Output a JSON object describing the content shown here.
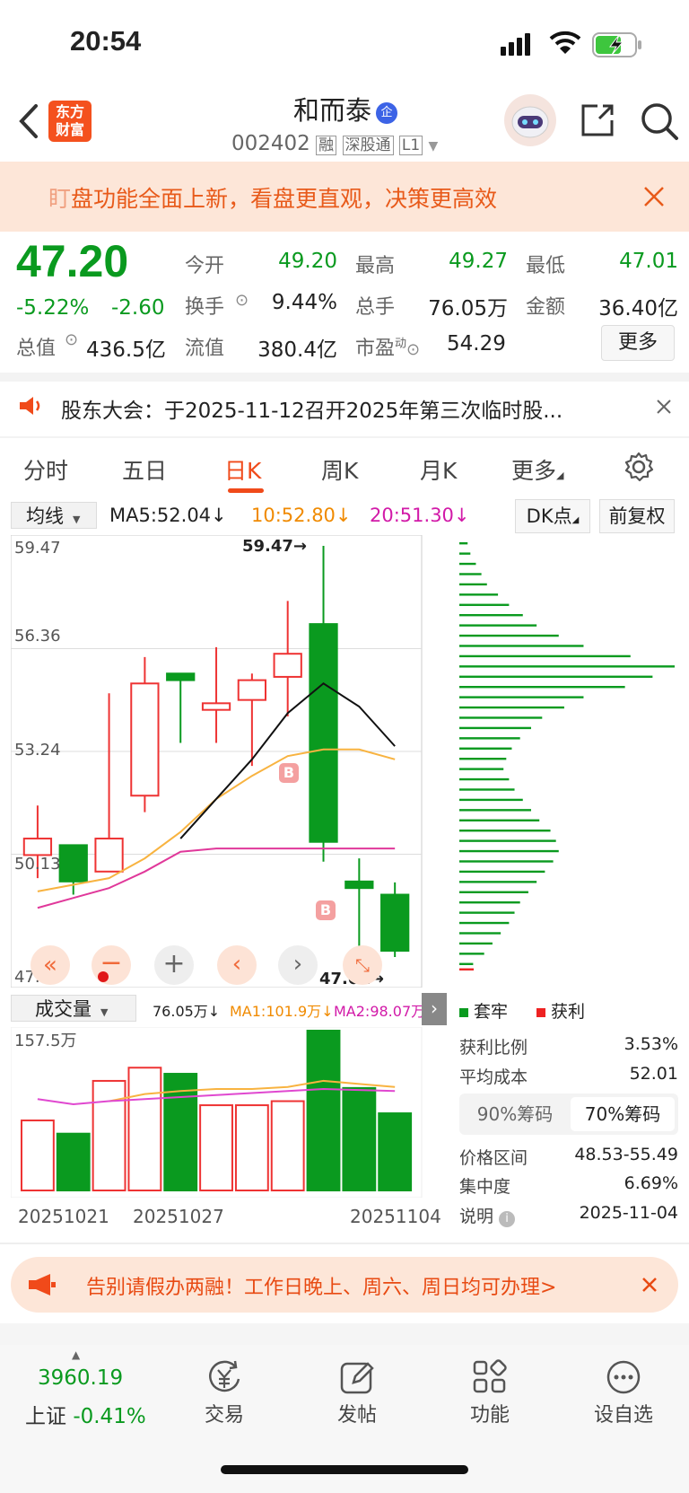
{
  "status": {
    "time": "20:54"
  },
  "header": {
    "logo_line1": "东方",
    "logo_line2": "财富",
    "stock_name": "和而泰",
    "badge": "企",
    "code": "002402",
    "tags": [
      "融",
      "深股通",
      "L1"
    ]
  },
  "banner1": {
    "prefix": "盯",
    "text": "盘功能全面上新，看盘更直观，决策更高效"
  },
  "quote": {
    "price": "47.20",
    "change_pct": "-5.22%",
    "change": "-2.60",
    "open_label": "今开",
    "open": "49.20",
    "high_label": "最高",
    "high": "49.27",
    "low_label": "最低",
    "low": "47.01",
    "turnover_label": "换手",
    "turnover": "9.44%",
    "volume_label": "总手",
    "volume": "76.05万",
    "amount_label": "金额",
    "amount": "36.40亿",
    "mktcap_label": "总值",
    "mktcap": "436.5亿",
    "float_label": "流值",
    "float": "380.4亿",
    "pe_label": "市盈",
    "pe_sup": "动",
    "pe": "54.29",
    "more_label": "更多"
  },
  "notice": {
    "text": "股东大会：于2025-11-12召开2025年第三次临时股..."
  },
  "tabs": [
    {
      "label": "分时"
    },
    {
      "label": "五日"
    },
    {
      "label": "日K",
      "active": true
    },
    {
      "label": "周K"
    },
    {
      "label": "月K"
    },
    {
      "label": "更多"
    }
  ],
  "ma_bar": {
    "selector": "均线",
    "ma5": "MA5:52.04↓",
    "ma10": "10:52.80↓",
    "ma20": "20:51.30↓",
    "dk": "DK点",
    "fq": "前复权"
  },
  "kchart": {
    "y_labels": [
      "59.47",
      "56.36",
      "53.24",
      "50.13",
      "47.01"
    ],
    "max_label": "59.47→",
    "min_label": "47.01→",
    "signal_b": "B"
  },
  "chart_data": {
    "type": "candlestick",
    "ylim": [
      47.01,
      59.47
    ],
    "candles": [
      {
        "open": 50.1,
        "close": 50.6,
        "high": 51.6,
        "low": 49.4
      },
      {
        "open": 50.4,
        "close": 49.3,
        "high": 50.4,
        "low": 48.9
      },
      {
        "open": 49.6,
        "close": 50.6,
        "high": 55.0,
        "low": 49.6
      },
      {
        "open": 51.9,
        "close": 55.3,
        "high": 56.1,
        "low": 51.4
      },
      {
        "open": 55.6,
        "close": 55.4,
        "high": 55.6,
        "low": 53.5
      },
      {
        "open": 54.5,
        "close": 54.7,
        "high": 56.4,
        "low": 53.5
      },
      {
        "open": 54.8,
        "close": 55.4,
        "high": 55.6,
        "low": 52.8
      },
      {
        "open": 55.5,
        "close": 56.2,
        "high": 57.8,
        "low": 54.3
      },
      {
        "open": 57.1,
        "close": 50.5,
        "high": 59.47,
        "low": 49.9
      },
      {
        "open": 49.3,
        "close": 49.1,
        "high": 50.0,
        "low": 47.3
      },
      {
        "open": 48.9,
        "close": 47.2,
        "high": 49.27,
        "low": 47.01
      }
    ],
    "ma5": [
      null,
      null,
      null,
      null,
      50.6,
      51.8,
      53.0,
      54.4,
      55.3,
      54.6,
      53.4
    ],
    "ma10": [
      49.0,
      49.2,
      49.4,
      50.0,
      50.8,
      51.8,
      52.5,
      53.1,
      53.3,
      53.3,
      53.0
    ],
    "ma20": [
      48.5,
      48.8,
      49.1,
      49.6,
      50.2,
      50.3,
      50.3,
      50.3,
      50.3,
      50.3,
      50.3
    ],
    "volume": [
      69,
      56,
      108,
      121,
      115,
      84,
      84,
      88,
      157.5,
      101,
      76.05
    ],
    "vol_ma1": [
      null,
      null,
      88,
      95,
      98,
      100,
      100,
      102,
      108,
      105,
      102
    ],
    "vol_ma2": [
      90,
      85,
      88,
      90,
      92,
      94,
      96,
      98,
      100,
      99,
      98
    ],
    "dates": [
      "20251021",
      "20251027",
      "20251104"
    ],
    "chip_bars": [
      3,
      4,
      6,
      8,
      10,
      14,
      18,
      23,
      28,
      36,
      45,
      62,
      78,
      70,
      60,
      45,
      38,
      30,
      26,
      22,
      19,
      17,
      16,
      18,
      20,
      23,
      26,
      29,
      33,
      35,
      36,
      34,
      31,
      28,
      25,
      22,
      20,
      18,
      15,
      12,
      9,
      5
    ]
  },
  "chip_legend": {
    "a": "套牢",
    "b": "获利"
  },
  "chip_stats": {
    "profit_ratio_label": "获利比例",
    "profit_ratio": "3.53%",
    "avg_cost_label": "平均成本",
    "avg_cost": "52.01",
    "tab90": "90%筹码",
    "tab70": "70%筹码",
    "range_label": "价格区间",
    "range": "48.53-55.49",
    "concentration_label": "集中度",
    "concentration": "6.69%",
    "note_label": "说明",
    "note_date": "2025-11-04"
  },
  "volume_bar": {
    "selector": "成交量",
    "vol": "76.05万↓",
    "ma1": "MA1:101.9万↓",
    "ma2": "MA2:98.07万",
    "max_label": "157.5万"
  },
  "banner2": {
    "text": "告别请假办两融！工作日晚上、周六、周日均可办理>"
  },
  "bottom": {
    "index_value": "3960.19",
    "index_name": "上证",
    "index_change": "-0.41%",
    "items": [
      {
        "label": "交易",
        "icon": "yen-icon"
      },
      {
        "label": "发帖",
        "icon": "edit-icon"
      },
      {
        "label": "功能",
        "icon": "grid-icon"
      },
      {
        "label": "设自选",
        "icon": "more-icon"
      }
    ]
  }
}
